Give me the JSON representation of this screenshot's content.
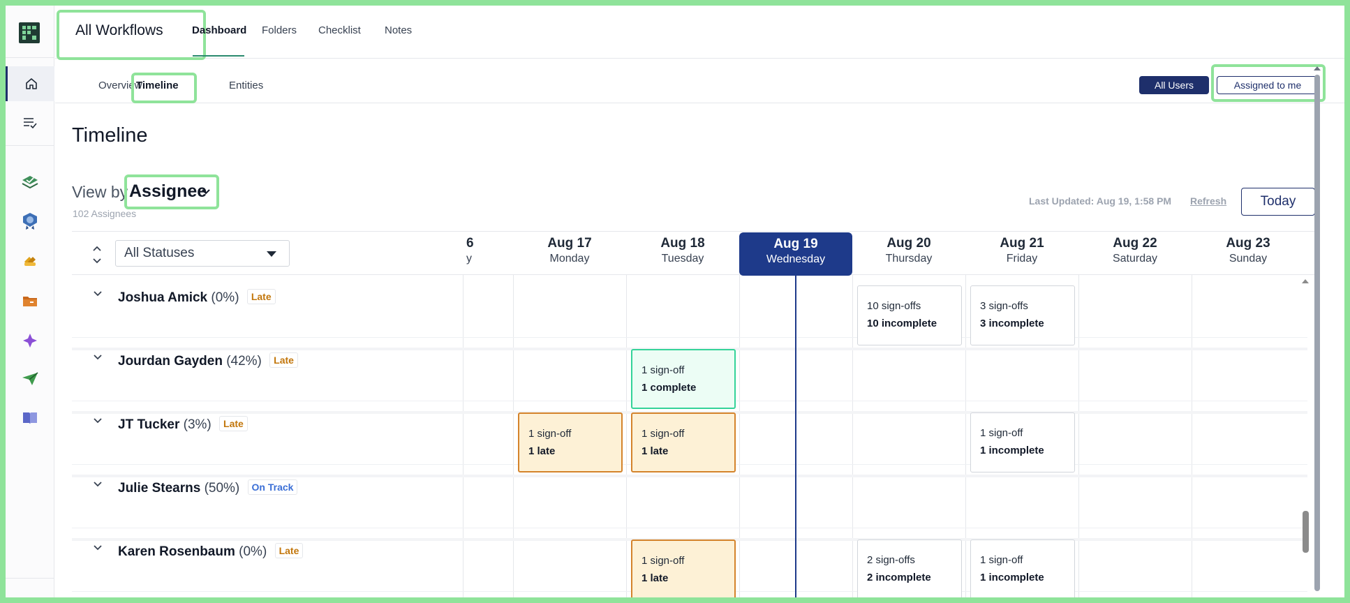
{
  "app": {
    "title": "All Workflows",
    "top_tabs": [
      "Dashboard",
      "Folders",
      "Checklist",
      "Notes"
    ],
    "active_top_tab": "Dashboard"
  },
  "subnav": {
    "tabs": [
      "Overview",
      "Timeline",
      "Entities"
    ],
    "active": "Timeline",
    "all_users": "All Users",
    "assigned_to_me": "Assigned to me"
  },
  "rail": {
    "icons": [
      "home-icon",
      "checklist-icon",
      "layers-check-icon",
      "badge-icon",
      "link-icon",
      "folder-icon",
      "sparkle-icon",
      "send-icon",
      "book-icon"
    ]
  },
  "page": {
    "title": "Timeline",
    "view_by_label": "View by",
    "view_by_value": "Assignee",
    "assignee_count": "102 Assignees",
    "last_updated": "Last Updated: Aug 19, 1:58 PM",
    "refresh": "Refresh",
    "today": "Today",
    "status_filter": "All Statuses"
  },
  "days": [
    {
      "date": "6",
      "weekday": "y",
      "partial": true
    },
    {
      "date": "Aug 17",
      "weekday": "Monday"
    },
    {
      "date": "Aug 18",
      "weekday": "Tuesday"
    },
    {
      "date": "Aug 19",
      "weekday": "Wednesday",
      "today": true
    },
    {
      "date": "Aug 20",
      "weekday": "Thursday"
    },
    {
      "date": "Aug 21",
      "weekday": "Friday"
    },
    {
      "date": "Aug 22",
      "weekday": "Saturday"
    },
    {
      "date": "Aug 23",
      "weekday": "Sunday"
    }
  ],
  "rows": [
    {
      "name": "Joshua Amick",
      "pct": "(0%)",
      "status": "Late"
    },
    {
      "name": "Jourdan Gayden",
      "pct": "(42%)",
      "status": "Late"
    },
    {
      "name": "JT Tucker",
      "pct": "(3%)",
      "status": "Late"
    },
    {
      "name": "Julie Stearns",
      "pct": "(50%)",
      "status": "On Track"
    },
    {
      "name": "Karen Rosenbaum",
      "pct": "(0%)",
      "status": "Late"
    }
  ],
  "cards": [
    {
      "row": 0,
      "day": "Aug 20",
      "line1": "10 sign-offs",
      "line2": "10 incomplete",
      "kind": "incomplete"
    },
    {
      "row": 0,
      "day": "Aug 21",
      "line1": "3 sign-offs",
      "line2": "3 incomplete",
      "kind": "incomplete"
    },
    {
      "row": 1,
      "day": "Aug 18",
      "line1": "1 sign-off",
      "line2": "1 complete",
      "kind": "complete"
    },
    {
      "row": 2,
      "day": "Aug 17",
      "line1": "1 sign-off",
      "line2": "1 late",
      "kind": "late"
    },
    {
      "row": 2,
      "day": "Aug 18",
      "line1": "1 sign-off",
      "line2": "1 late",
      "kind": "late"
    },
    {
      "row": 2,
      "day": "Aug 21",
      "line1": "1 sign-off",
      "line2": "1 incomplete",
      "kind": "incomplete"
    },
    {
      "row": 4,
      "day": "Aug 18",
      "line1": "1 sign-off",
      "line2": "1 late",
      "kind": "late"
    },
    {
      "row": 4,
      "day": "Aug 20",
      "line1": "2 sign-offs",
      "line2": "2 incomplete",
      "kind": "incomplete"
    },
    {
      "row": 4,
      "day": "Aug 21",
      "line1": "1 sign-off",
      "line2": "1 incomplete",
      "kind": "incomplete"
    }
  ],
  "colors": {
    "brand": "#1e2f6b",
    "today": "#1e3a8a",
    "late_text": "#c2760b",
    "ontrack_text": "#3b6fd6",
    "complete_bg": "#ecfdf5",
    "late_bg": "#fdf1d6"
  }
}
